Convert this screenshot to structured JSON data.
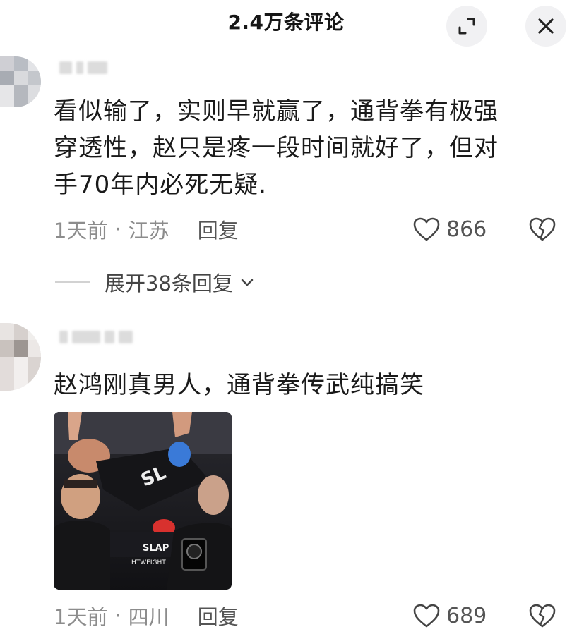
{
  "header": {
    "title": "2.4万条评论",
    "expand_icon": "expand-icon",
    "close_icon": "close-icon"
  },
  "comments": [
    {
      "text": "看似输了，实则早就赢了，通背拳有极强穿透性，赵只是疼一段时间就好了，但对手70年内必死无疑.",
      "lines": [
        "看似输了，实则早就赢了，通背拳有极强",
        "穿透性，赵只是疼一段时间就好了，但对",
        "手70年内必死无疑."
      ],
      "time": "1天前",
      "separator": "·",
      "location": "江苏",
      "reply_label": "回复",
      "likes": "866",
      "expand_replies": "展开38条回复"
    },
    {
      "text": "赵鸿刚真男人，通背拳传武纯搞笑",
      "time": "1天前",
      "separator": "·",
      "location": "四川",
      "reply_label": "回复",
      "likes": "689",
      "photo": {
        "banner_text": "SLAP",
        "banner_subtext": "HTWEIGHT"
      }
    }
  ],
  "colors": {
    "text": "#1a1a1a",
    "meta": "#8c8c8c",
    "header_button_bg": "#f1f1f3"
  }
}
